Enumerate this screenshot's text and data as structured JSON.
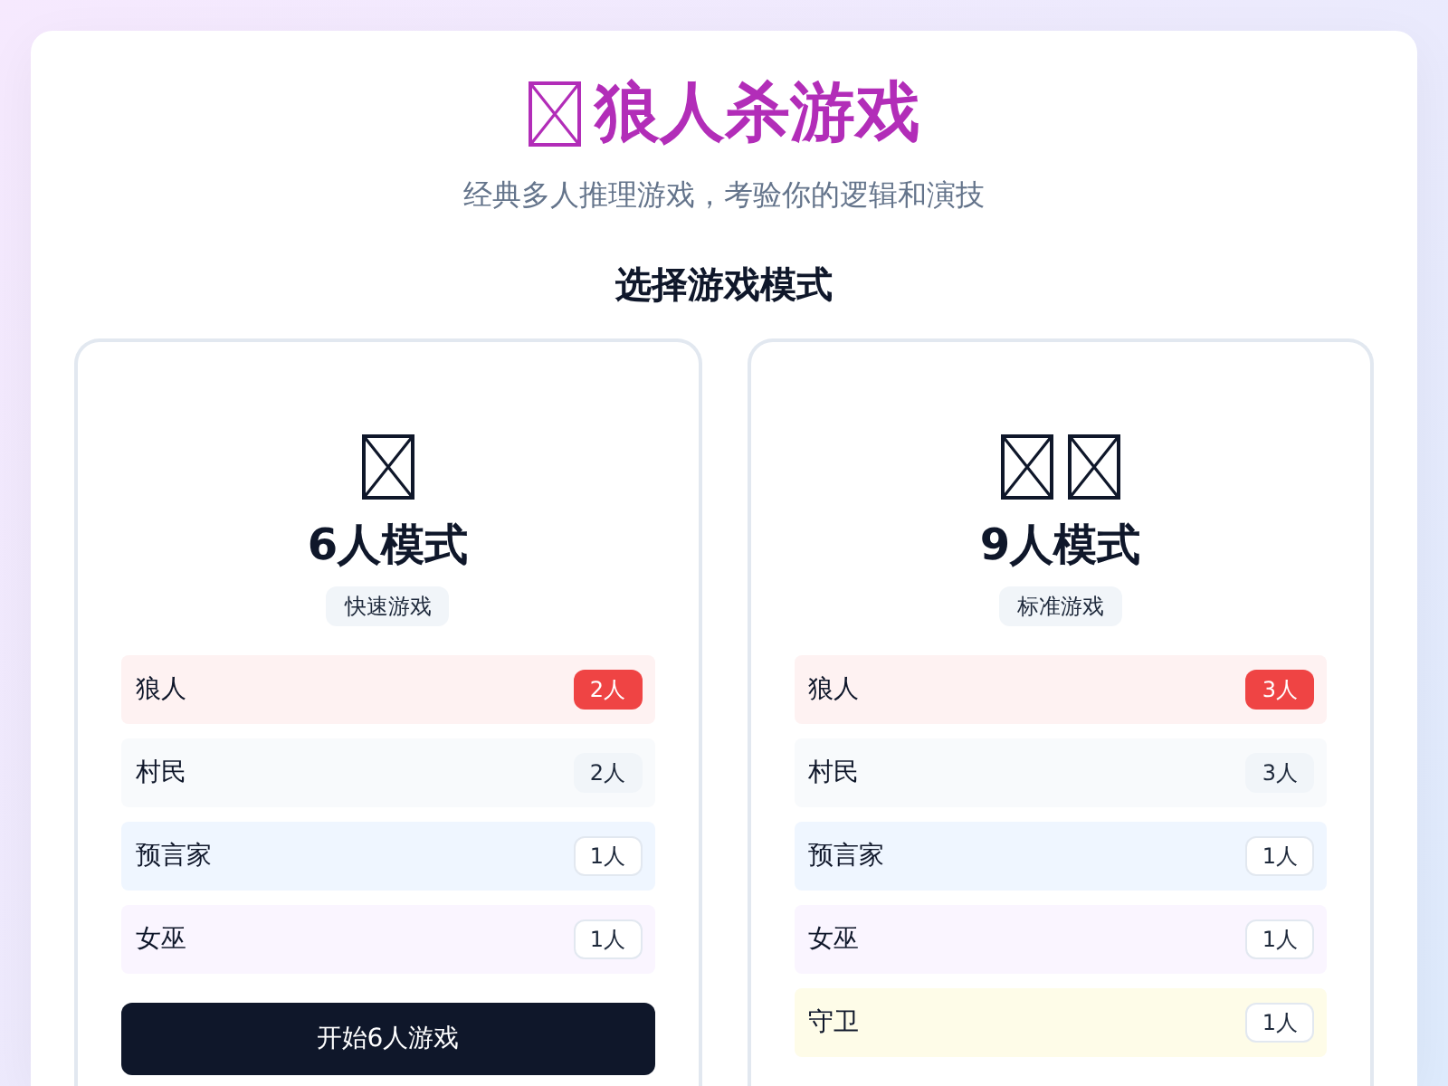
{
  "header": {
    "icons": [
      {
        "kind": "missing-glyph"
      }
    ],
    "title": "狼人杀游戏",
    "subtitle": "经典多人推理游戏，考验你的逻辑和演技"
  },
  "section_title": "选择游戏模式",
  "modes": [
    {
      "icons": [
        {
          "kind": "missing-glyph"
        }
      ],
      "title": "6人模式",
      "tag": "快速游戏",
      "roles": [
        {
          "name": "狼人",
          "count": "2人",
          "color": "#fef2f2",
          "kind": "danger"
        },
        {
          "name": "村民",
          "count": "2人",
          "color": "#f8fafc",
          "kind": "muted"
        },
        {
          "name": "预言家",
          "count": "1人",
          "color": "#eff6ff",
          "kind": "outline"
        },
        {
          "name": "女巫",
          "count": "1人",
          "color": "#faf5ff",
          "kind": "outline"
        }
      ],
      "button": "开始6人游戏"
    },
    {
      "icons": [
        {
          "kind": "missing-glyph"
        },
        {
          "kind": "missing-glyph"
        }
      ],
      "title": "9人模式",
      "tag": "标准游戏",
      "roles": [
        {
          "name": "狼人",
          "count": "3人",
          "color": "#fef2f2",
          "kind": "danger"
        },
        {
          "name": "村民",
          "count": "3人",
          "color": "#f8fafc",
          "kind": "muted"
        },
        {
          "name": "预言家",
          "count": "1人",
          "color": "#eff6ff",
          "kind": "outline"
        },
        {
          "name": "女巫",
          "count": "1人",
          "color": "#faf5ff",
          "kind": "outline"
        },
        {
          "name": "守卫",
          "count": "1人",
          "color": "#fefce8",
          "kind": "outline"
        }
      ]
    }
  ]
}
